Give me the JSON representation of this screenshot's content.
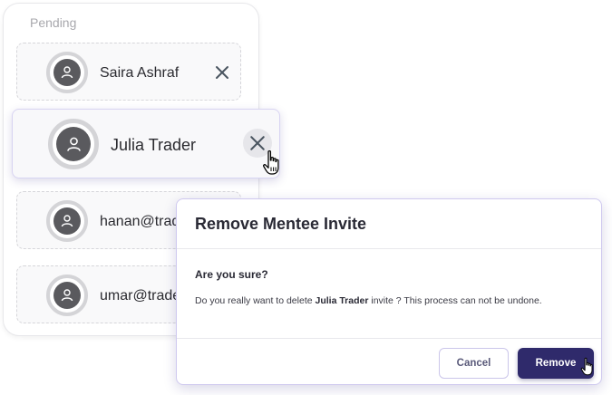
{
  "pending_panel": {
    "title": "Pending",
    "invites": [
      {
        "name": "Saira Ashraf"
      },
      {
        "name": "Julia Trader"
      },
      {
        "name": "hanan@trad"
      },
      {
        "name": "umar@trade"
      }
    ]
  },
  "dialog": {
    "title": "Remove Mentee Invite",
    "question": "Are you sure?",
    "message_prefix": "Do you really want to delete ",
    "message_name": "Julia Trader",
    "message_suffix": " invite ? This process can not be undone.",
    "cancel_label": "Cancel",
    "remove_label": "Remove"
  },
  "colors": {
    "primary": "#2f2a6b",
    "avatar": "#5a5a5e",
    "close_icon": "#4a5560"
  },
  "icons": {
    "avatar": "user-icon",
    "remove": "close-icon",
    "cursor": "hand-pointer-icon"
  }
}
